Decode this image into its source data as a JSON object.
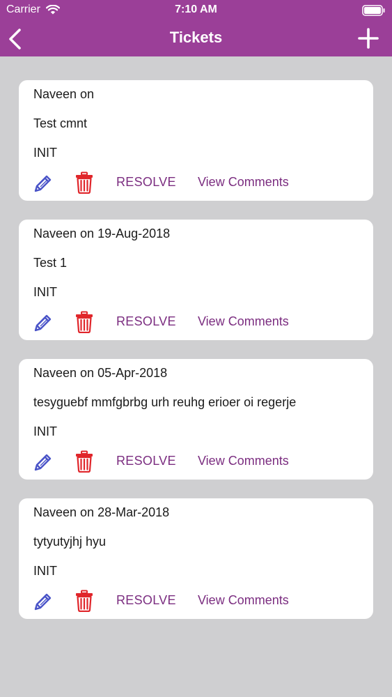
{
  "status_bar": {
    "carrier": "Carrier",
    "time": "7:10 AM"
  },
  "nav": {
    "title": "Tickets",
    "back_icon": "chevron-left-icon",
    "add_icon": "plus-icon"
  },
  "colors": {
    "header": "#9b3f98",
    "background": "#cfcfd1",
    "link": "#7b2d80",
    "edit_icon": "#4a54c8",
    "delete_icon": "#e0262b"
  },
  "tickets": [
    {
      "header": "Naveen on",
      "comment": "Test cmnt",
      "status": "INIT",
      "resolve_label": "RESOLVE",
      "comments_label": "View Comments"
    },
    {
      "header": "Naveen on 19-Aug-2018",
      "comment": "Test 1",
      "status": "INIT",
      "resolve_label": "RESOLVE",
      "comments_label": "View Comments"
    },
    {
      "header": "Naveen on 05-Apr-2018",
      "comment": "tesyguebf mmfgbrbg urh reuhg erioer oi regerje",
      "status": "INIT",
      "resolve_label": "RESOLVE",
      "comments_label": "View Comments"
    },
    {
      "header": "Naveen on 28-Mar-2018",
      "comment": "tytyutyjhj hyu",
      "status": "INIT",
      "resolve_label": "RESOLVE",
      "comments_label": "View Comments"
    }
  ]
}
